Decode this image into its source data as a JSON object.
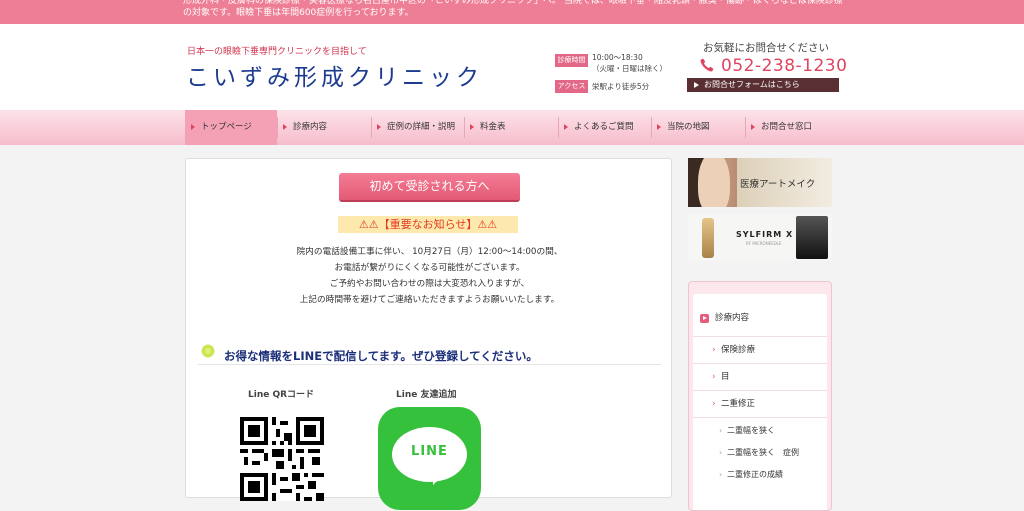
{
  "announcement": "形成外科・皮膚科の保険診療・美容医療なら名古屋市中区の「こいずみ形成クリニック」へ。 当院では、眼瞼下垂・陥没乳頭・腋臭・傷跡・ほくろなどは保険診療の対象です。眼瞼下垂は年間600症例を行っております。",
  "header": {
    "tagline": "日本一の眼瞼下垂専門クリニックを目指して",
    "logo": "こいずみ形成クリニック",
    "hours_badge": "診療時間",
    "hours_line1": "10:00〜18:30",
    "hours_line2": "（火曜・日曜は除く）",
    "access_badge": "アクセス",
    "access": "栄駅より徒歩5分",
    "contact_title": "お気軽にお問合せください",
    "phone": "052-238-1230",
    "form_button": "お問合せフォームはこちら"
  },
  "nav": {
    "items": [
      {
        "label": "トップページ"
      },
      {
        "label": "診療内容"
      },
      {
        "label": "症例の詳細・説明"
      },
      {
        "label": "料金表"
      },
      {
        "label": "よくあるご質問"
      },
      {
        "label": "当院の地図"
      },
      {
        "label": "お問合せ窓口"
      }
    ],
    "active_index": 0
  },
  "main": {
    "first_visit_button": "初めて受診される方へ",
    "notice_title": "⚠⚠【重要なお知らせ】⚠⚠",
    "notice_lines": [
      "院内の電話設備工事に伴い、 10月27日（月）12:00〜14:00の間、",
      "お電話が繋がりにくくなる可能性がございます。",
      "ご予約やお問い合わせの際は大変恐れ入りますが、",
      "上記の時間帯を避けてご連絡いただきますようお願いいたします。"
    ],
    "line_heading": "お得な情報をLINEで配信してます。ぜひ登録してください。",
    "qr_title": "Line QRコード",
    "add_friend_title": "Line 友達追加",
    "line_logo_text": "LINE"
  },
  "sidebar": {
    "banner1_text": "医療アートメイク",
    "banner2_brand": "SYLFIRM X",
    "banner2_sub": "RF MICRONEEDLE",
    "menu": {
      "top": "診療内容",
      "items": [
        {
          "label": "保険診療"
        },
        {
          "label": "目"
        },
        {
          "label": "二重修正"
        }
      ],
      "subitems": [
        {
          "label": "二重幅を狭く"
        },
        {
          "label": "二重幅を狭く　症例"
        },
        {
          "label": "二重修正の成績"
        }
      ]
    }
  },
  "colors": {
    "topbar": "#ee7e95",
    "accent": "#e04460",
    "logo": "#1d3b8f",
    "nav_active": "#f4a1b6",
    "line_green": "#35c13c"
  },
  "icons": [
    "phone-icon",
    "arrow-right-icon",
    "warning-icon",
    "line-logo-icon",
    "qr-code-icon",
    "chevron-right-icon"
  ]
}
